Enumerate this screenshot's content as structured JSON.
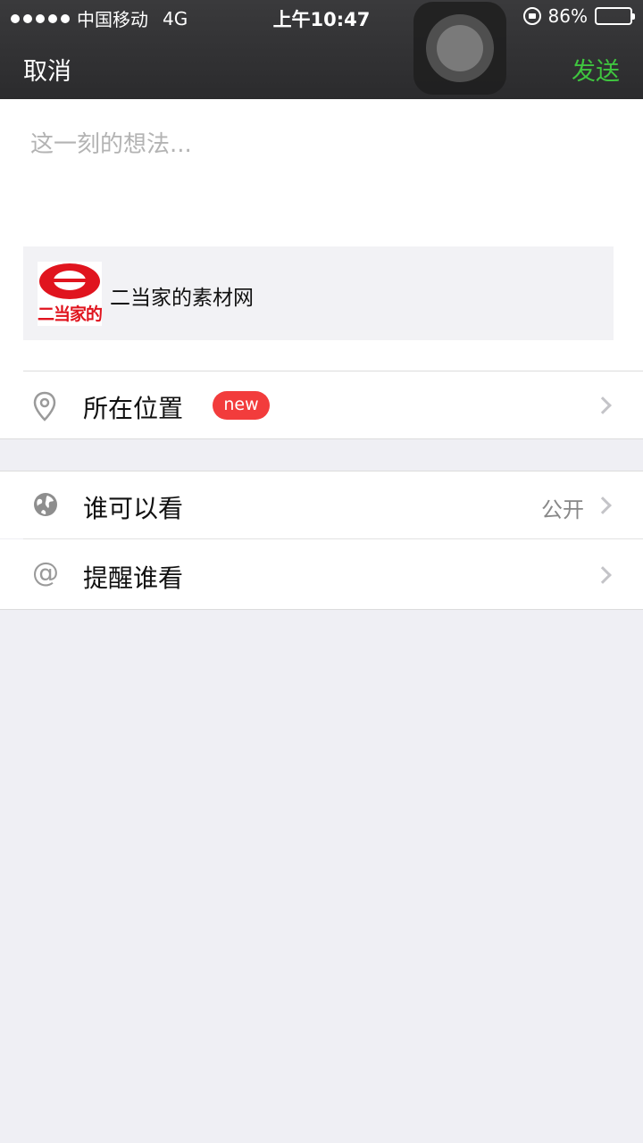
{
  "status_bar": {
    "carrier": "中国移动",
    "network": "4G",
    "time": "上午10:47",
    "battery": "86%",
    "battery_level": 0.86
  },
  "nav": {
    "cancel_label": "取消",
    "send_label": "发送"
  },
  "compose": {
    "placeholder": "这一刻的想法..."
  },
  "link_card": {
    "logo_text": "二当家的",
    "title": "二当家的素材网"
  },
  "options": {
    "location": {
      "label": "所在位置",
      "badge": "new"
    },
    "visibility": {
      "label": "谁可以看",
      "value": "公开"
    },
    "mention": {
      "label": "提醒谁看",
      "icon_glyph": "@"
    }
  },
  "colors": {
    "accent_green": "#3fc53f",
    "badge_red": "#f23c3c",
    "logo_red": "#e0141e"
  }
}
